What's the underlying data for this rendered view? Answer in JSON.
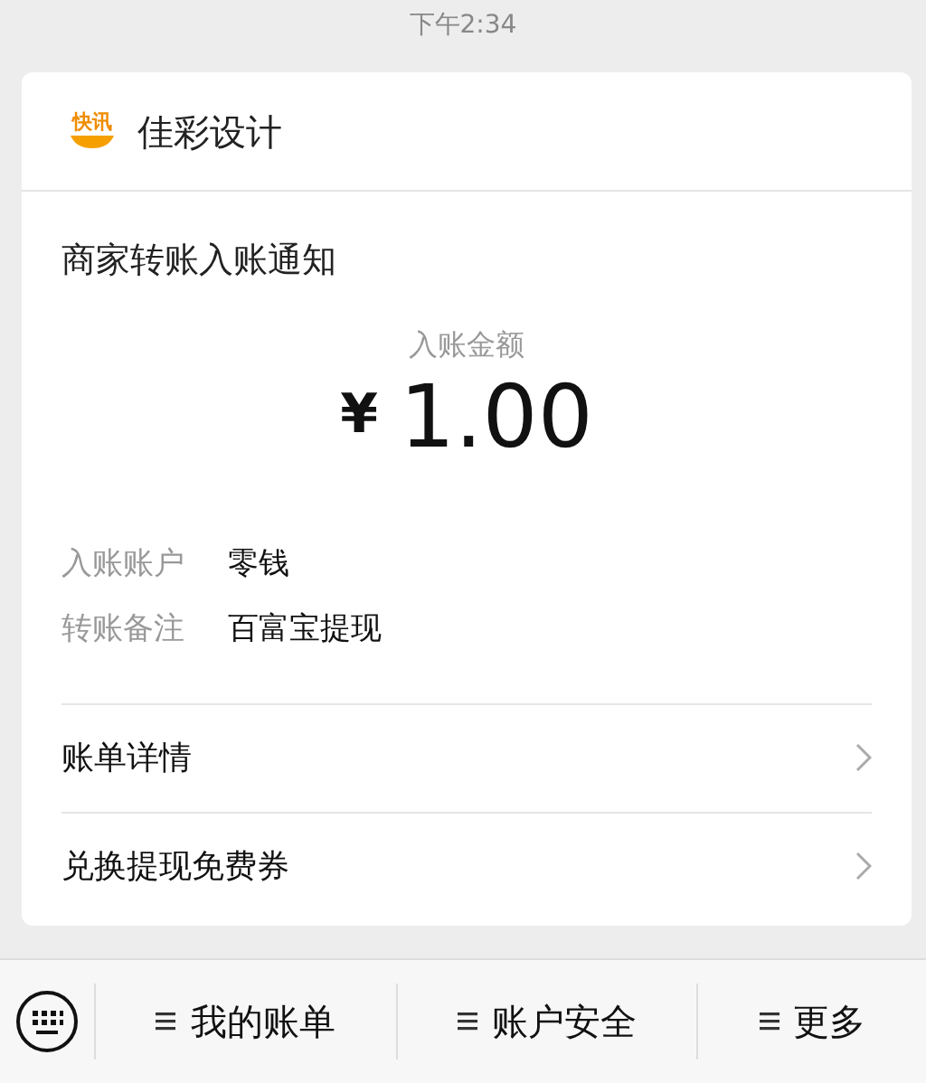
{
  "status_bar": {
    "time": "下午2:34"
  },
  "card": {
    "logo_text": "快讯",
    "sender": "佳彩设计",
    "title": "商家转账入账通知",
    "amount_label": "入账金额",
    "currency": "¥",
    "amount": "1.00",
    "fields": [
      {
        "label": "入账账户",
        "value": "零钱"
      },
      {
        "label": "转账备注",
        "value": "百富宝提现"
      }
    ],
    "links": [
      {
        "label": "账单详情"
      },
      {
        "label": "兑换提现免费券"
      }
    ]
  },
  "bottom_menu": [
    {
      "label": "我的账单"
    },
    {
      "label": "账户安全"
    },
    {
      "label": "更多"
    }
  ]
}
